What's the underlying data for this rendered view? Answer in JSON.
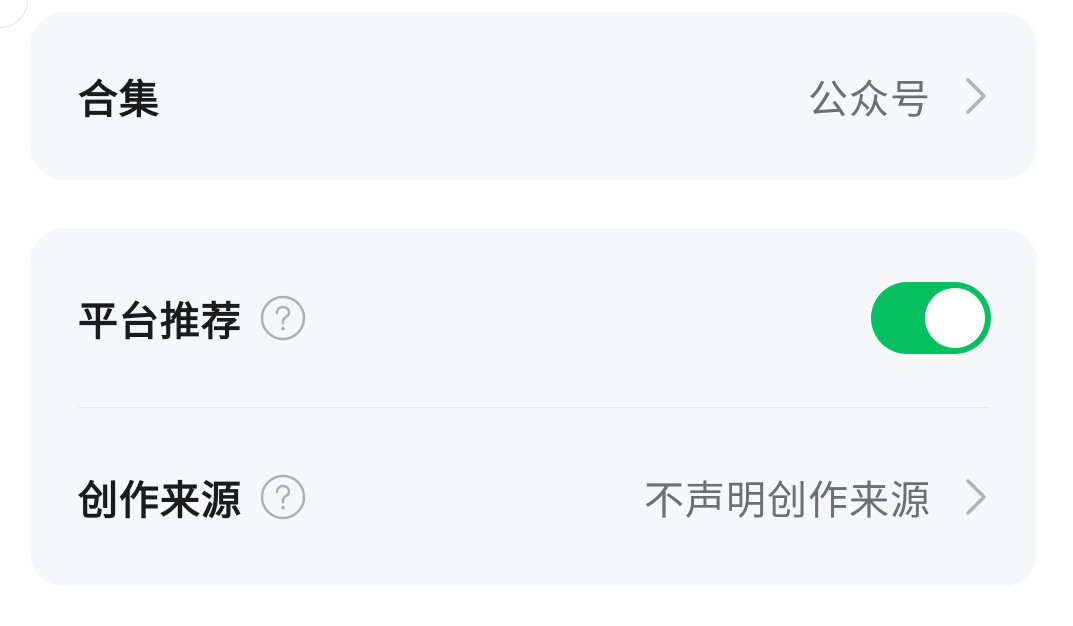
{
  "collection": {
    "label": "合集",
    "value": "公众号",
    "chevron_icon": "chevron-right-icon"
  },
  "settings": {
    "recommend": {
      "label": "平台推荐",
      "help_icon": "question-circle-icon",
      "toggle_on": true,
      "toggle_color": "#07c160"
    },
    "source": {
      "label": "创作来源",
      "help_icon": "question-circle-icon",
      "value": "不声明创作来源",
      "chevron_icon": "chevron-right-icon"
    }
  }
}
